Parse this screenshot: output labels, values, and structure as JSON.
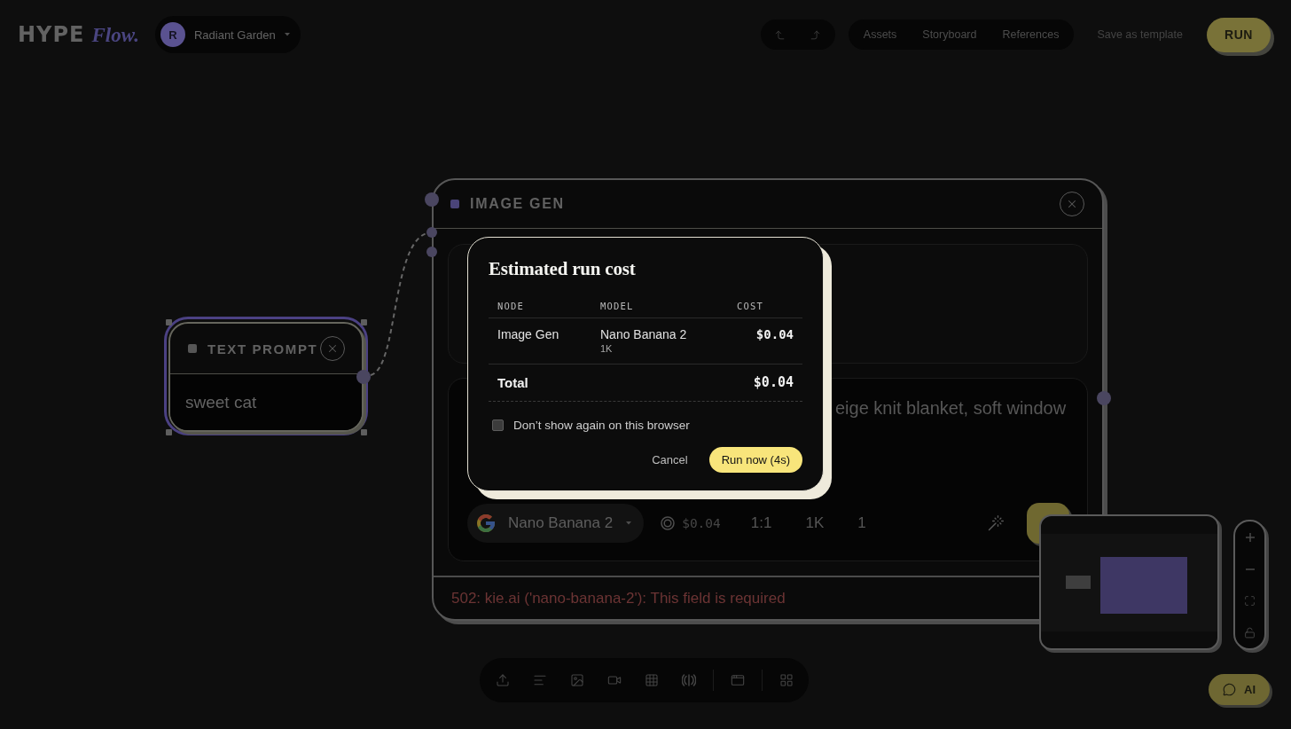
{
  "header": {
    "logo": {
      "wordmark": "HYPE",
      "suffix": "Flow."
    },
    "workspace": {
      "initial": "R",
      "name": "Radiant Garden"
    },
    "nav": [
      {
        "label": "Assets"
      },
      {
        "label": "Storyboard"
      },
      {
        "label": "References"
      }
    ],
    "save_template": "Save as template",
    "run_button": "RUN"
  },
  "canvas": {
    "nodes": [
      {
        "kind": "text_prompt",
        "title": "TEXT PROMPT",
        "color": "#565656",
        "selected": true,
        "value": "sweet cat"
      },
      {
        "kind": "image_gen",
        "title": "IMAGE GEN",
        "color": "#4a4478",
        "selected": false,
        "prompt": "eige knit blanket, soft window",
        "model": "Nano Banana 2",
        "cost": "$0.04",
        "aspect_ratio": "1:1",
        "resolution": "1K",
        "count": "1",
        "error": "502: kie.ai ('nano-banana-2'): This field is required"
      }
    ]
  },
  "dialog": {
    "title": "Estimated run cost",
    "columns": [
      "NODE",
      "MODEL",
      "COST"
    ],
    "rows": [
      {
        "node": "Image Gen",
        "model": "Nano Banana 2",
        "detail": "1K",
        "cost": "$0.04"
      }
    ],
    "total": {
      "label": "Total",
      "cost": "$0.04"
    },
    "checkbox": {
      "label": "Don’t show again on this browser",
      "checked": false
    },
    "buttons": [
      {
        "kind": "cancel",
        "label": "Cancel"
      },
      {
        "kind": "confirm",
        "label": "Run now (4s)"
      }
    ]
  },
  "ai_button": {
    "label": "AI"
  }
}
